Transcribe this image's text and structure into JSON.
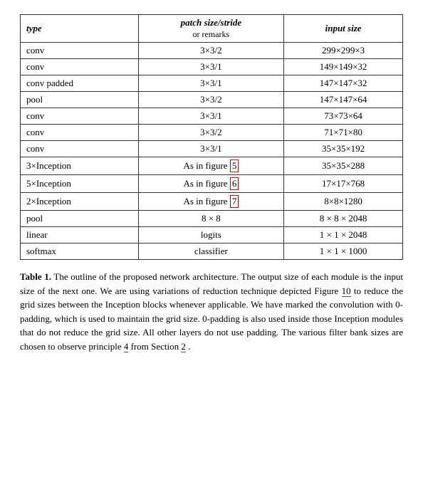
{
  "table": {
    "headers": [
      {
        "id": "type",
        "label": "type",
        "sub": ""
      },
      {
        "id": "patch",
        "label": "patch size/stride",
        "sub": "or remarks"
      },
      {
        "id": "input",
        "label": "input size",
        "sub": ""
      }
    ],
    "rows": [
      {
        "type": "conv",
        "patch": "3×3/2",
        "input": "299×299×3"
      },
      {
        "type": "conv",
        "patch": "3×3/1",
        "input": "149×149×32"
      },
      {
        "type": "conv padded",
        "patch": "3×3/1",
        "input": "147×147×32"
      },
      {
        "type": "pool",
        "patch": "3×3/2",
        "input": "147×147×64"
      },
      {
        "type": "conv",
        "patch": "3×3/1",
        "input": "73×73×64"
      },
      {
        "type": "conv",
        "patch": "3×3/2",
        "input": "71×71×80"
      },
      {
        "type": "conv",
        "patch": "3×3/1",
        "input": "35×35×192"
      },
      {
        "type": "3×Inception",
        "patch": "As in figure 5",
        "patch_ref": "5",
        "input": "35×35×288"
      },
      {
        "type": "5×Inception",
        "patch": "As in figure 6",
        "patch_ref": "6",
        "input": "17×17×768"
      },
      {
        "type": "2×Inception",
        "patch": "As in figure 7",
        "patch_ref": "7",
        "input": "8×8×1280"
      },
      {
        "type": "pool",
        "patch": "8 × 8",
        "input": "8 × 8 × 2048"
      },
      {
        "type": "linear",
        "patch": "logits",
        "input": "1 × 1 × 2048"
      },
      {
        "type": "softmax",
        "patch": "classifier",
        "input": "1 × 1 × 1000"
      }
    ]
  },
  "caption": {
    "label": "Table 1.",
    "text": " The outline of the proposed network architecture.  The output size of each module is the input size of the next one.  We are using variations of reduction technique depicted Figure ",
    "ref1": "10",
    "text2": " to reduce the grid sizes between the Inception blocks whenever applicable.  We have marked the convolution with 0-padding, which is used to maintain the grid size.  0-padding is also used inside those Inception modules that do not reduce the grid size.  All other layers do not use padding.  The various filter bank sizes are chosen to observe principle ",
    "ref2": "4",
    "text3": " from Section ",
    "ref3": "2",
    "text4": "."
  },
  "highlighted_rows": [
    7,
    8,
    9
  ],
  "highlighted_cells": [
    "5",
    "6",
    "7"
  ]
}
